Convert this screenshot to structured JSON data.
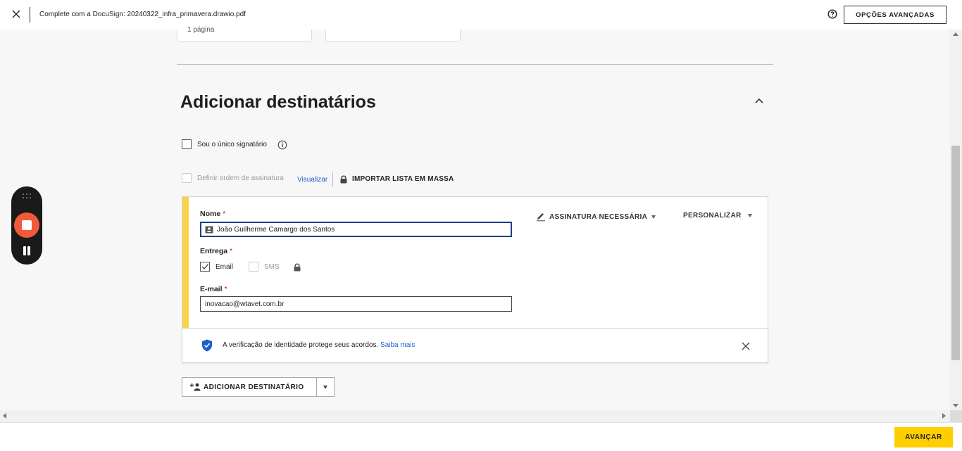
{
  "window": {
    "title": "Complete com a DocuSign: 20240322_infra_primavera.drawio.pdf",
    "advanced_options_label": "OPÇÕES AVANÇADAS"
  },
  "documents": {
    "card1_pages": "1 página"
  },
  "section": {
    "title": "Adicionar destinatários"
  },
  "options": {
    "only_signer_label": "Sou o único signatário",
    "signing_order_label": "Definir ordem de assinatura",
    "view_link": "Visualizar",
    "bulk_import_label": "IMPORTAR LISTA EM MASSA"
  },
  "recipient": {
    "name_label": "Nome",
    "name_value": "João Guilherme Camargo dos Santos",
    "delivery_label": "Entrega",
    "email_option": "Email",
    "sms_option": "SMS",
    "email_label": "E-mail",
    "email_value": "inovacao@wtavet.com.br",
    "required_mark": "*",
    "signature_menu": "ASSINATURA NECESSÁRIA",
    "customize_menu": "PERSONALIZAR"
  },
  "identity_banner": {
    "message": "A verificação de identidade protege seus acordos.",
    "learn_more": "Saiba mais"
  },
  "actions": {
    "add_recipient": "ADICIONAR DESTINATÁRIO",
    "next": "AVANÇAR"
  },
  "colors": {
    "accent_yellow": "#ffce00",
    "card_accent": "#f8d34a",
    "link_blue": "#1f5ec9",
    "record_red": "#f05a3a",
    "shield_blue": "#1f5ec9"
  }
}
